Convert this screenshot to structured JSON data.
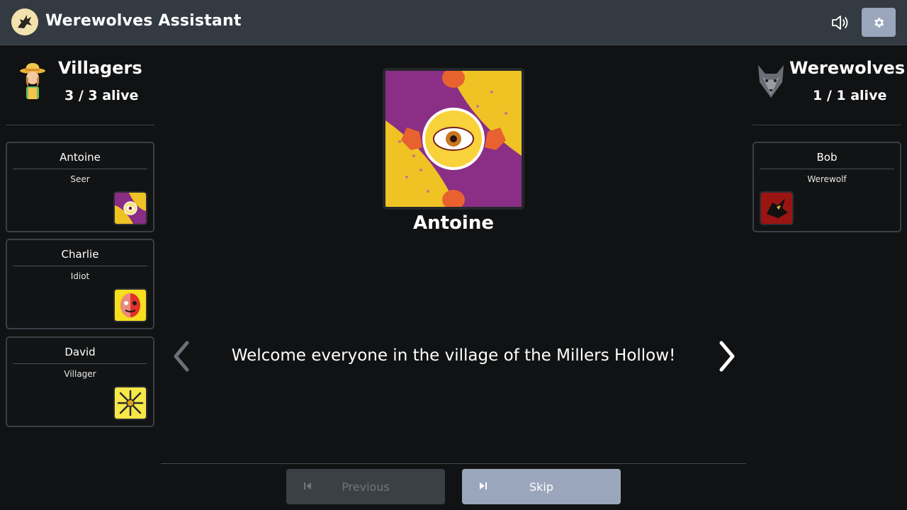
{
  "header": {
    "title": "Werewolves Assistant",
    "logo_icon": "wolf-logo-icon",
    "sound_icon": "speaker-icon",
    "settings_icon": "gear-icon"
  },
  "villagers": {
    "title": "Villagers",
    "alive": "3 / 3 alive",
    "icon": "villager-avatar-icon",
    "players": [
      {
        "name": "Antoine",
        "role": "Seer",
        "icon": "seer-card-icon"
      },
      {
        "name": "Charlie",
        "role": "Idiot",
        "icon": "idiot-card-icon"
      },
      {
        "name": "David",
        "role": "Villager",
        "icon": "villager-card-icon"
      }
    ]
  },
  "werewolves": {
    "title": "Werewolves",
    "alive": "1 / 1 alive",
    "icon": "wolf-avatar-icon",
    "players": [
      {
        "name": "Bob",
        "role": "Werewolf",
        "icon": "werewolf-card-icon"
      }
    ]
  },
  "main": {
    "current_player": "Antoine",
    "narration": "Welcome everyone in the village of the Millers Hollow!"
  },
  "footer": {
    "previous_label": "Previous",
    "skip_label": "Skip"
  },
  "colors": {
    "header_bg": "#343a42",
    "page_bg": "#111213",
    "accent_button": "#99a6bb",
    "disabled_button": "#3b4046"
  }
}
